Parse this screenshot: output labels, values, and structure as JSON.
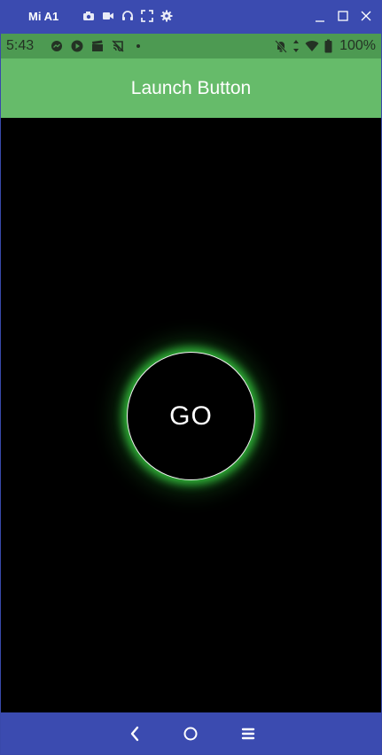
{
  "emulator": {
    "title": "Mi A1",
    "tools": [
      "camera-icon",
      "video-icon",
      "headset-icon",
      "fullscreen-icon",
      "settings-icon"
    ],
    "window_controls": [
      "minimize-icon",
      "maximize-icon",
      "close-icon"
    ]
  },
  "status_bar": {
    "time": "5:43",
    "battery_percent": "100%",
    "left_icons": [
      "messenger-icon",
      "play-icon",
      "clapper-icon",
      "cast-off-icon",
      "dot-icon"
    ],
    "right_icons": [
      "notifications-off-icon",
      "data-arrows-icon",
      "wifi-icon",
      "battery-icon"
    ]
  },
  "app_bar": {
    "title": "Launch Button"
  },
  "main": {
    "go_label": "GO"
  },
  "colors": {
    "app_bar": "#66bb6a",
    "status_bar": "#4d9a52",
    "nav_bar": "#3b4bb0",
    "glow": "#3cdc46"
  },
  "nav_bar": {
    "buttons": [
      "back-icon",
      "home-icon",
      "menu-icon"
    ]
  }
}
